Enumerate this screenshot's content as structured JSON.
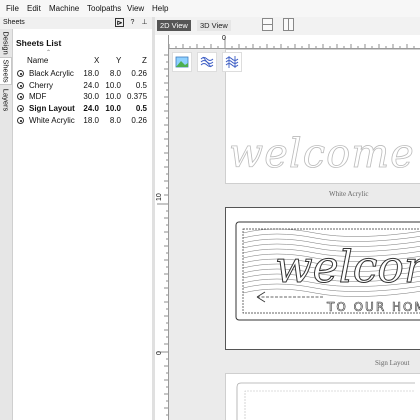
{
  "menubar": {
    "items": [
      "File",
      "Edit",
      "Machine",
      "Toolpaths",
      "View",
      "Help"
    ]
  },
  "panel": {
    "title": "Sheets",
    "pin_glyph": "⊳",
    "help_glyph": "?",
    "close_glyph": "⊥"
  },
  "side_tabs": [
    "Design",
    "Sheets",
    "Layers"
  ],
  "sheets": {
    "title": "Sheets List",
    "columns": [
      "Name",
      "X",
      "Y",
      "Z"
    ],
    "rows": [
      {
        "name": "Black Acrylic",
        "x": "18.0",
        "y": "8.0",
        "z": "0.26",
        "bold": false
      },
      {
        "name": "Cherry",
        "x": "24.0",
        "y": "10.0",
        "z": "0.5",
        "bold": false
      },
      {
        "name": "MDF",
        "x": "30.0",
        "y": "10.0",
        "z": "0.375",
        "bold": false
      },
      {
        "name": "Sign Layout",
        "x": "24.0",
        "y": "10.0",
        "z": "0.5",
        "bold": true
      },
      {
        "name": "White Acrylic",
        "x": "18.0",
        "y": "8.0",
        "z": "0.26",
        "bold": false
      }
    ]
  },
  "view_tabs": {
    "tab_2d": "2D View",
    "tab_3d": "3D View",
    "active": "2D View"
  },
  "rulers": {
    "top_label": "0",
    "left_labels": [
      "10",
      "0"
    ]
  },
  "canvas": {
    "toolbar_icons": [
      "image-icon",
      "toolpath-wave-icon",
      "toolpath-grid-icon"
    ],
    "sheet_labels": {
      "white_acrylic": "White Acrylic",
      "sign_layout": "Sign Layout"
    },
    "artwork_text": {
      "white_acrylic_script": "welcome",
      "sign_script": "welcome",
      "sign_subtext": "TO OUR HOME"
    }
  },
  "colors": {
    "active_tab_bg": "#555555",
    "canvas_bg": "#ebebeb",
    "sheet_bg": "#ffffff"
  }
}
